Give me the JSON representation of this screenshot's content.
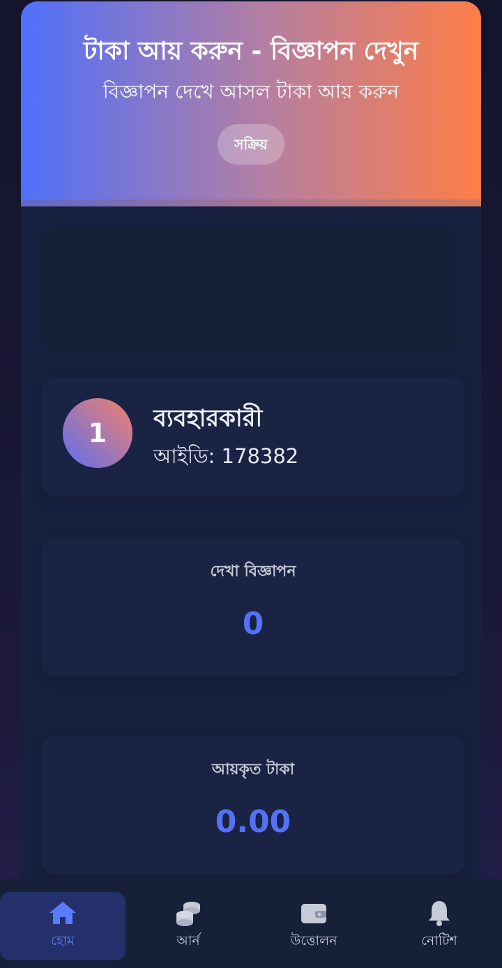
{
  "header": {
    "title": "টাকা আয় করুন - বিজ্ঞাপন দেখুন",
    "subtitle": "বিজ্ঞাপন দেখে আসল টাকা আয় করুন",
    "status": "সক্রিয়"
  },
  "user": {
    "avatar_initial": "1",
    "name": "ব্যবহারকারী",
    "id_label": "আইডি:",
    "id_value": "178382"
  },
  "stats": [
    {
      "label": "দেখা বিজ্ঞাপন",
      "value": "0"
    },
    {
      "label": "আয়কৃত টাকা",
      "value": "0.00"
    }
  ],
  "nav": {
    "items": [
      {
        "label": "হোম",
        "icon": "home-icon",
        "active": true
      },
      {
        "label": "আর্ন",
        "icon": "coins-icon",
        "active": false
      },
      {
        "label": "উত্তোলন",
        "icon": "wallet-icon",
        "active": false
      },
      {
        "label": "নোটিশ",
        "icon": "bell-icon",
        "active": false
      }
    ]
  },
  "colors": {
    "header_gradient_start": "#4f70fb",
    "header_gradient_end": "#ff7d47",
    "accent": "#5472f5",
    "card_bg": "#1a2343",
    "nav_active_bg": "#24306a"
  }
}
